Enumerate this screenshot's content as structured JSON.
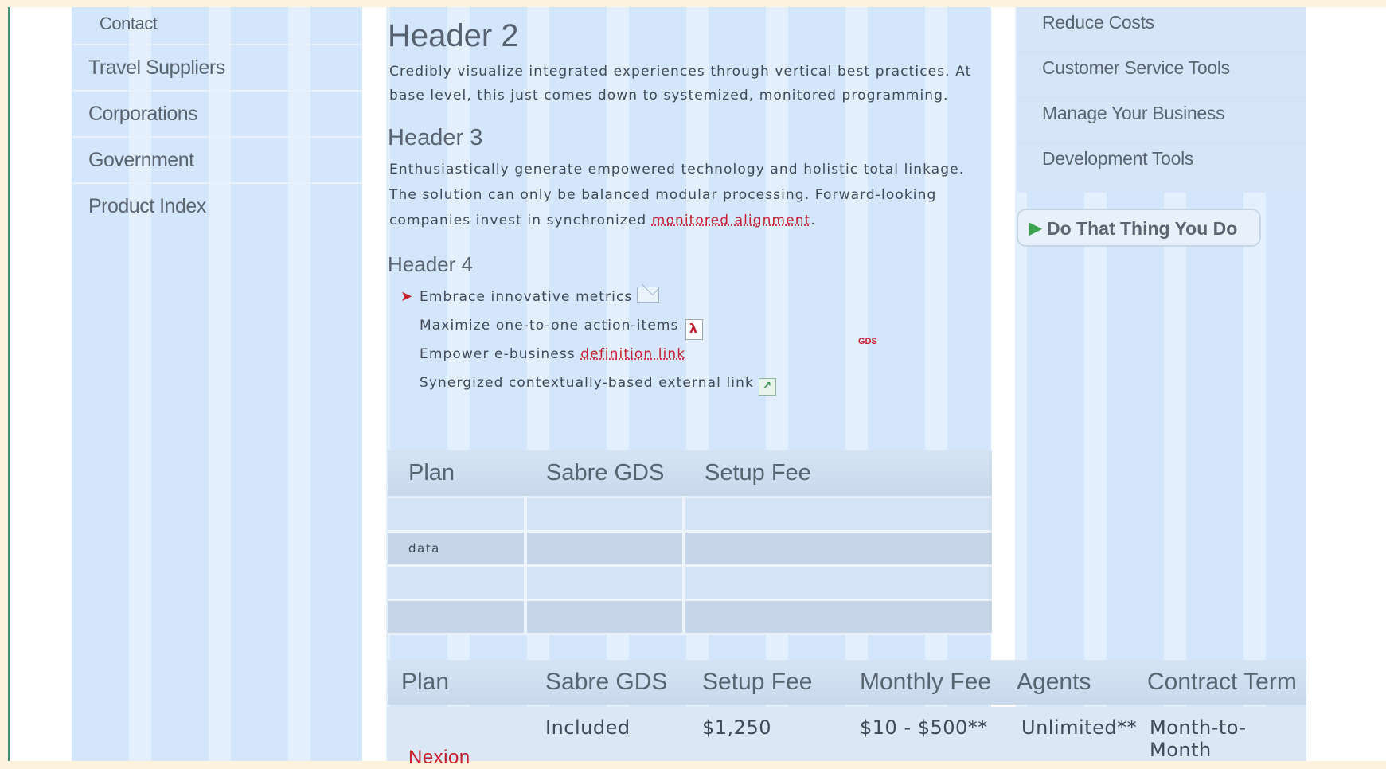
{
  "left_nav": {
    "items": [
      "Contact",
      "Travel Suppliers",
      "Corporations",
      "Government",
      "Product Index"
    ]
  },
  "main": {
    "h2": "Header 2",
    "p2": "Credibly visualize integrated experiences through vertical best practices. At base level, this just comes down to systemized, monitored programming.",
    "h3": "Header 3",
    "p3_text": "Enthusiastically generate empowered technology and holistic total linkage. The solution can only be balanced modular processing. Forward-looking companies invest in synchronized",
    "p3_link": "monitored alignment",
    "p3_end": ".",
    "h4": "Header 4",
    "list": [
      {
        "text": "Embrace innovative metrics",
        "icon": "mail-icon"
      },
      {
        "text": "Maximize one-to-one action-items",
        "icon": "pdf-icon"
      },
      {
        "text": "Empower e-business",
        "link": "definition link"
      },
      {
        "text": "Synergized contextually-based external link",
        "icon": "external-link-icon"
      }
    ],
    "gds_tag": "GDS"
  },
  "table1": {
    "headers": [
      "Plan",
      "Sabre GDS",
      "Setup Fee"
    ],
    "rows": [
      [
        "",
        "",
        ""
      ],
      [
        "data",
        "",
        ""
      ],
      [
        "",
        "",
        ""
      ],
      [
        "",
        "",
        ""
      ]
    ]
  },
  "table2": {
    "headers": [
      "Plan",
      "Sabre GDS",
      "Setup Fee",
      "Monthly Fee",
      "Agents",
      "Contract Term"
    ],
    "row": {
      "plan": "Nexion",
      "sabre": "Included",
      "setup": "$1,250",
      "monthly": "$10 - $500**",
      "agents": "Unlimited**",
      "term": "Month-to-Month"
    }
  },
  "right_nav": {
    "items": [
      "Reduce Costs",
      "Customer Service Tools",
      "Manage Your Business",
      "Development Tools"
    ]
  },
  "cta": {
    "label": "Do That Thing You Do"
  },
  "colors": {
    "accent_red": "#c4202b",
    "accent_green": "#3ba34d",
    "column_blue": "#d4e6fb",
    "page_bg": "#fdf3dc"
  }
}
